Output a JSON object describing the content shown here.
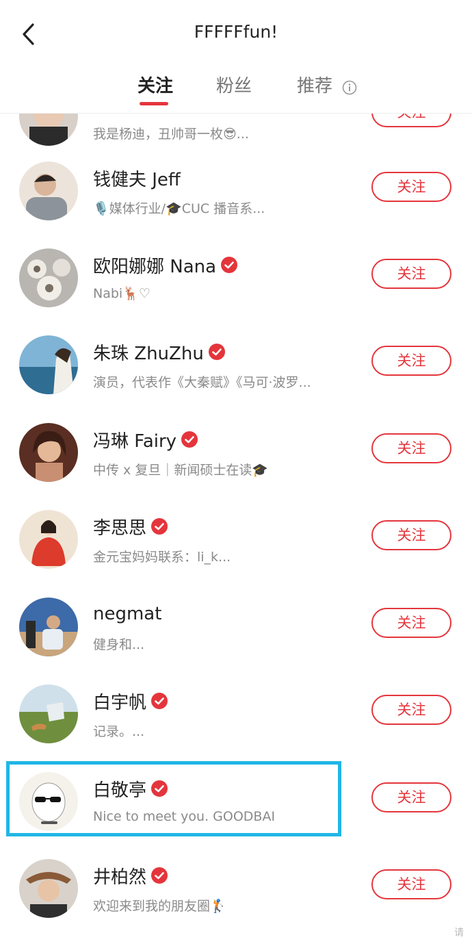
{
  "header": {
    "title": "FFFFFfun!",
    "tabs": [
      {
        "label": "关注",
        "active": true
      },
      {
        "label": "粉丝",
        "active": false
      },
      {
        "label": "推荐",
        "active": false
      }
    ]
  },
  "accent_color": "#e4353c",
  "highlight_color": "#20b6e6",
  "users": [
    {
      "name": "",
      "desc": "我是杨迪，丑帅哥一枚😎...",
      "verified": false,
      "follow_label": "关注"
    },
    {
      "name": "钱健夫 Jeff",
      "desc": "🎙️媒体行业/🎓CUC 播音系...",
      "verified": false,
      "follow_label": "关注"
    },
    {
      "name": "欧阳娜娜 Nana",
      "desc": "Nabi🦌♡",
      "verified": true,
      "follow_label": "关注"
    },
    {
      "name": "朱珠 ZhuZhu",
      "desc": "演员，代表作《大秦赋》《马可·波罗...",
      "verified": true,
      "follow_label": "关注"
    },
    {
      "name": "冯琳 Fairy",
      "desc": "中传 x 复旦｜新闻硕士在读🎓",
      "verified": true,
      "follow_label": "关注"
    },
    {
      "name": "李思思",
      "desc": "金元宝妈妈联系：li_k...",
      "verified": true,
      "follow_label": "关注"
    },
    {
      "name": "negmat",
      "desc": "健身和...",
      "verified": false,
      "follow_label": "关注"
    },
    {
      "name": "白宇帆",
      "desc": "记录。...",
      "verified": true,
      "follow_label": "关注"
    },
    {
      "name": "白敬亭",
      "desc": "Nice to meet you. GOODBAI",
      "verified": true,
      "follow_label": "关注",
      "highlighted": true
    },
    {
      "name": "井柏然",
      "desc": "欢迎来到我的朋友圈🏌️",
      "verified": true,
      "follow_label": "关注"
    }
  ],
  "watermark": "请"
}
